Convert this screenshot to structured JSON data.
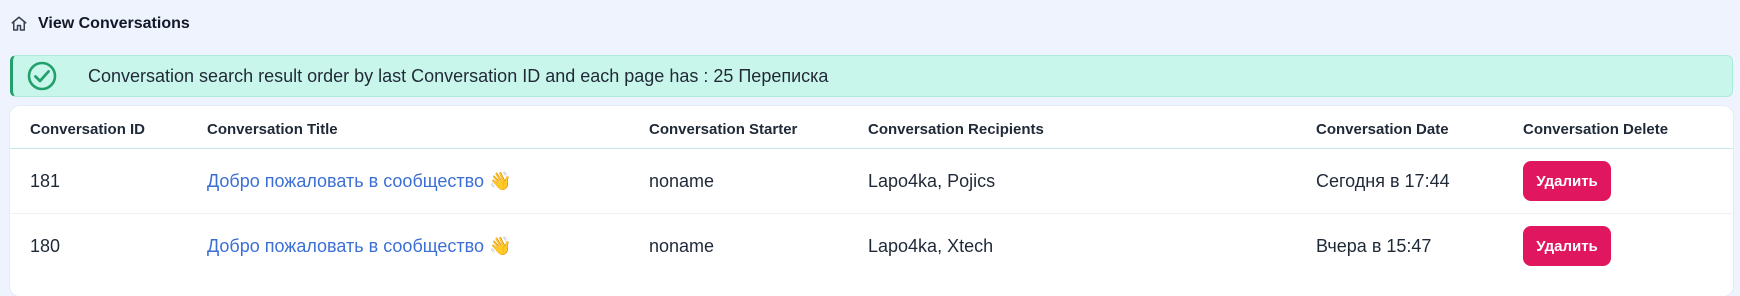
{
  "breadcrumb": {
    "icon": "home-icon",
    "title": "View Conversations"
  },
  "alert": {
    "icon": "check-circle-icon",
    "message": "Conversation search result order by last Conversation ID and each page has : 25 Переписка",
    "accent_color": "#22a06b",
    "background_color": "#c9f6ea"
  },
  "table": {
    "headers": {
      "id": "Conversation ID",
      "title": "Conversation Title",
      "starter": "Conversation Starter",
      "recipients": "Conversation Recipients",
      "date": "Conversation Date",
      "delete": "Conversation Delete"
    },
    "rows": [
      {
        "id": "181",
        "title": "Добро пожаловать в сообщество 👋",
        "starter": "noname",
        "recipients": "Lapo4ka, Pojics",
        "date": "Сегодня в 17:44",
        "delete_label": "Удалить"
      },
      {
        "id": "180",
        "title": "Добро пожаловать в сообщество 👋",
        "starter": "noname",
        "recipients": "Lapo4ka, Xtech",
        "date": "Вчера в 15:47",
        "delete_label": "Удалить"
      }
    ]
  },
  "colors": {
    "link": "#3b6fd6",
    "delete_button": "#e0165f",
    "page_background": "#eef3fd"
  }
}
